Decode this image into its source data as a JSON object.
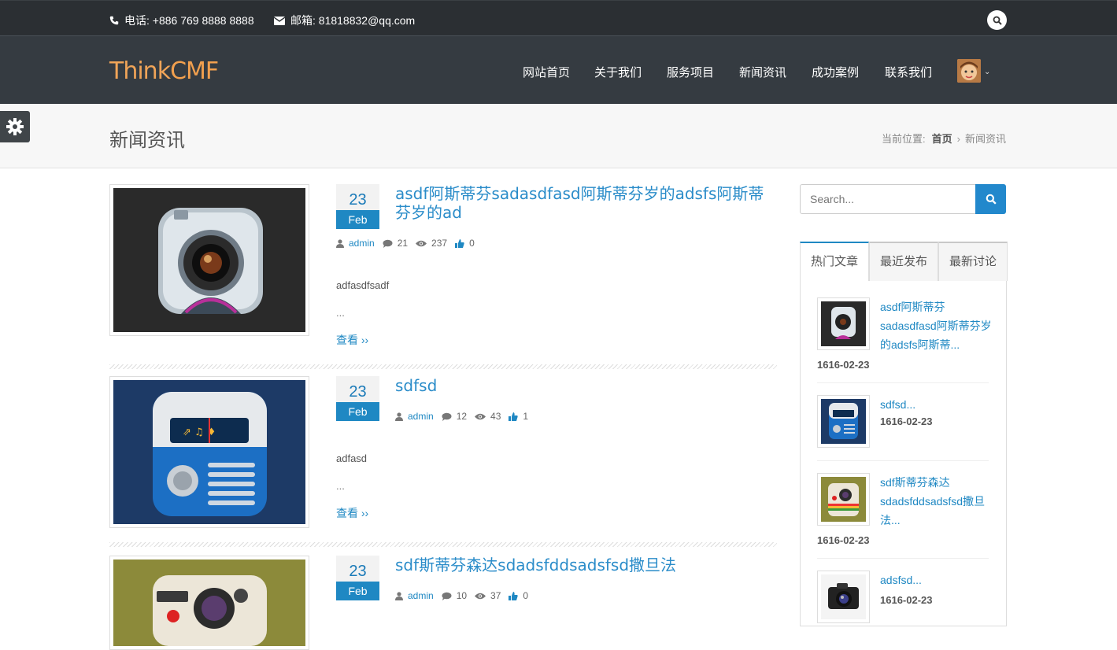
{
  "topbar": {
    "phone": "电话: +886 769 8888 8888",
    "email": "邮箱: 81818832@qq.com"
  },
  "brand": {
    "logo_part1": "Think",
    "logo_part2": "CMF"
  },
  "nav": {
    "items": [
      "网站首页",
      "关于我们",
      "服务项目",
      "新闻资讯",
      "成功案例",
      "联系我们"
    ]
  },
  "page": {
    "title": "新闻资讯",
    "breadcrumb_prefix": "当前位置:",
    "breadcrumb_home": "首页",
    "breadcrumb_sep": "›",
    "breadcrumb_current": "新闻资讯"
  },
  "posts": [
    {
      "day": "23",
      "month": "Feb",
      "title": "asdf阿斯蒂芬sadasdfasd阿斯蒂芬岁的adsfs阿斯蒂芬岁的ad",
      "author": "admin",
      "comments": "21",
      "views": "237",
      "likes": "0",
      "excerpt": "adfasdfsadf",
      "ellipsis": "...",
      "more": "查看 ››"
    },
    {
      "day": "23",
      "month": "Feb",
      "title": "sdfsd",
      "author": "admin",
      "comments": "12",
      "views": "43",
      "likes": "1",
      "excerpt": "adfasd",
      "ellipsis": "...",
      "more": "查看 ››"
    },
    {
      "day": "23",
      "month": "Feb",
      "title": "sdf斯蒂芬森达sdadsfddsadsfsd撒旦法",
      "author": "admin",
      "comments": "10",
      "views": "37",
      "likes": "0"
    }
  ],
  "sidebar": {
    "search_placeholder": "Search...",
    "tabs": [
      "热门文章",
      "最近发布",
      "最新讨论"
    ],
    "items": [
      {
        "title": "asdf阿斯蒂芬sadasdfasd阿斯蒂芬岁的adsfs阿斯蒂...",
        "date": "1616-02-23"
      },
      {
        "title": "sdfsd...",
        "date": "1616-02-23"
      },
      {
        "title": "sdf斯蒂芬森达sdadsfddsadsfsd撒旦法...",
        "date": "1616-02-23"
      },
      {
        "title": "adsfsd...",
        "date": "1616-02-23"
      }
    ]
  },
  "colors": {
    "accent": "#1f88c3",
    "topbar": "#2b2f33",
    "navbar": "#353b41"
  }
}
